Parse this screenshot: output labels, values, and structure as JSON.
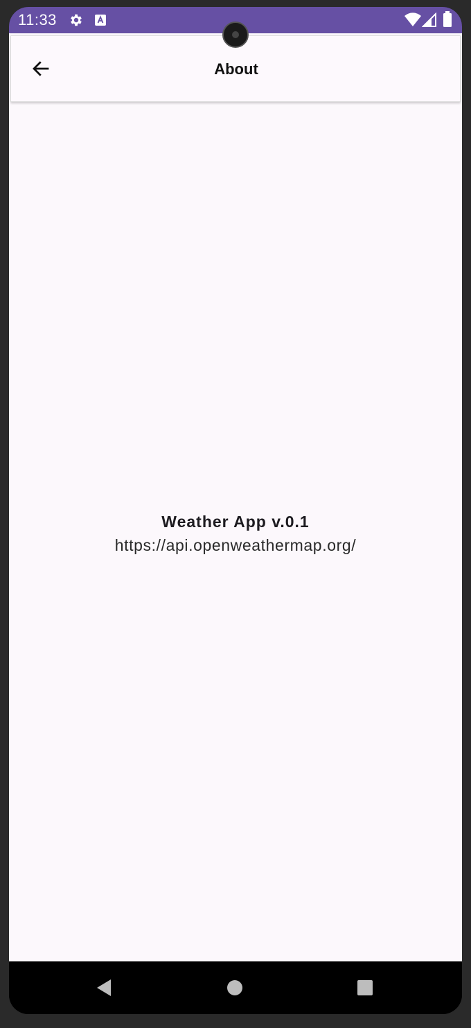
{
  "status_bar": {
    "time": "11:33",
    "background_color": "#6650a4",
    "icons_left": [
      "gear-icon",
      "text-a-icon"
    ],
    "icons_right": [
      "wifi-icon",
      "signal-icon",
      "battery-icon"
    ]
  },
  "app_bar": {
    "title": "About",
    "back_icon": "arrow-left-icon"
  },
  "content": {
    "app_name": "Weather App v.0.1",
    "api_url": "https://api.openweathermap.org/"
  },
  "nav_bar": {
    "buttons": [
      "back-triangle-icon",
      "home-circle-icon",
      "recents-square-icon"
    ]
  }
}
